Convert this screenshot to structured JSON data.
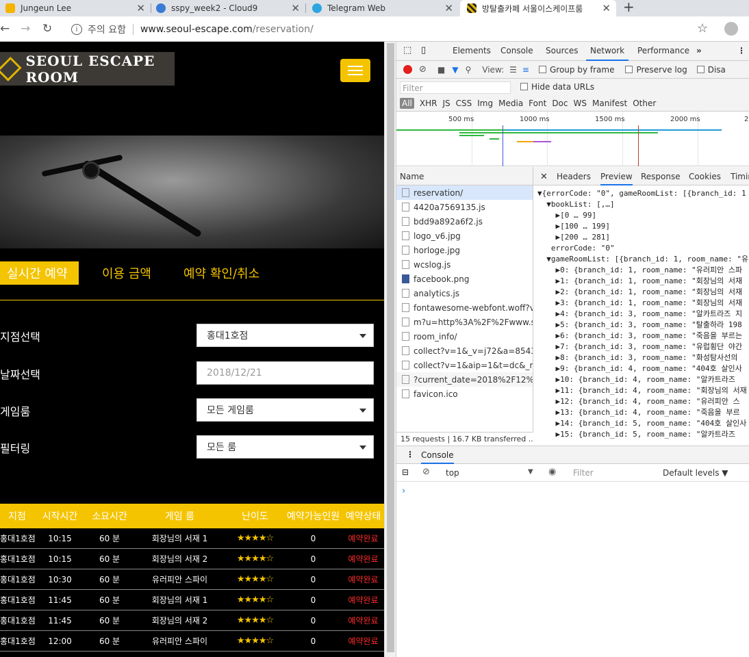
{
  "browser": {
    "tabs": [
      {
        "title": "Jungeun Lee",
        "icon": "google-icon"
      },
      {
        "title": "sspy_week2 - Cloud9",
        "icon": "cloud9-icon"
      },
      {
        "title": "Telegram Web",
        "icon": "telegram-icon"
      },
      {
        "title": "방탈출카페 서울이스케이프룸",
        "icon": "seoul-escape-icon"
      }
    ],
    "warning": "주의 요함",
    "url_host": "www.seoul-escape.com",
    "url_path": "/reservation/"
  },
  "site": {
    "logo_text": "SEOUL ESCAPE ROOM",
    "tabs": [
      "실시간 예약",
      "이용 금액",
      "예약 확인/취소"
    ],
    "filters": [
      {
        "label": "지점선택",
        "value": "홍대1호점"
      },
      {
        "label": "날짜선택",
        "value": "2018/12/21"
      },
      {
        "label": "게임룸",
        "value": "모든 게임룸"
      },
      {
        "label": "필터링",
        "value": "모든 룸"
      }
    ],
    "table": {
      "headers": [
        "지점",
        "시작시간",
        "소요시간",
        "게임 룸",
        "난이도",
        "예약가능인원",
        "예약상태"
      ],
      "rows": [
        [
          "홍대1호점",
          "10:15",
          "60 분",
          "회장님의 서재 1",
          "★★★★☆",
          "0",
          "예약완료"
        ],
        [
          "홍대1호점",
          "10:15",
          "60 분",
          "회장님의 서재 2",
          "★★★★☆",
          "0",
          "예약완료"
        ],
        [
          "홍대1호점",
          "10:30",
          "60 분",
          "유러피안 스파이",
          "★★★★☆",
          "0",
          "예약완료"
        ],
        [
          "홍대1호점",
          "11:45",
          "60 분",
          "회장님의 서재 1",
          "★★★★☆",
          "0",
          "예약완료"
        ],
        [
          "홍대1호점",
          "11:45",
          "60 분",
          "회장님의 서재 2",
          "★★★★☆",
          "0",
          "예약완료"
        ],
        [
          "홍대1호점",
          "12:00",
          "60 분",
          "유러피안 스파이",
          "★★★★☆",
          "0",
          "예약완료"
        ]
      ]
    }
  },
  "devtools": {
    "panels": [
      "Elements",
      "Console",
      "Sources",
      "Network",
      "Performance"
    ],
    "toolbar": {
      "view": "View:",
      "group": "Group by frame",
      "preserve": "Preserve log",
      "disable": "Disa"
    },
    "filter_placeholder": "Filter",
    "hide_data": "Hide data URLs",
    "types": [
      "All",
      "XHR",
      "JS",
      "CSS",
      "Img",
      "Media",
      "Font",
      "Doc",
      "WS",
      "Manifest",
      "Other"
    ],
    "ticks": [
      "500 ms",
      "1000 ms",
      "1500 ms",
      "2000 ms",
      "2"
    ],
    "name_header": "Name",
    "requests": [
      "reservation/",
      "4420a7569135.js",
      "bdd9a892a6f2.js",
      "logo_v6.jpg",
      "horloge.jpg",
      "wcslog.js",
      "facebook.png",
      "analytics.js",
      "fontawesome-webfont.woff?v...",
      "m?u=http%3A%2F%2Fwww.se...",
      "room_info/",
      "collect?v=1&_v=j72&a=85439...",
      "collect?v=1&aip=1&t=dc&_r=...",
      "?current_date=2018%2F12%2F...",
      "favicon.ico"
    ],
    "detail_tabs": [
      "Headers",
      "Preview",
      "Response",
      "Cookies",
      "Timin"
    ],
    "preview_lines": [
      "▼{errorCode: \"0\", gameRoomList: [{branch_id: 1",
      "  ▼bookList: [,…]",
      "    ▶[0 … 99]",
      "    ▶[100 … 199]",
      "    ▶[200 … 281]",
      "   errorCode: \"0\"",
      "  ▼gameRoomList: [{branch_id: 1, room_name: \"유",
      "    ▶0: {branch_id: 1, room_name: \"유러피안 스파",
      "    ▶1: {branch_id: 1, room_name: \"회장님의 서재",
      "    ▶2: {branch_id: 1, room_name: \"회장님의 서재",
      "    ▶3: {branch_id: 1, room_name: \"회장님의 서재",
      "    ▶4: {branch_id: 3, room_name: \"알카트라즈 지",
      "    ▶5: {branch_id: 3, room_name: \"탈출하라 198",
      "    ▶6: {branch_id: 3, room_name: \"죽음을 부르는",
      "    ▶7: {branch_id: 3, room_name: \"유럽횡단 야간",
      "    ▶8: {branch_id: 3, room_name: \"화성탐사선의",
      "    ▶9: {branch_id: 4, room_name: \"404호 살인사",
      "    ▶10: {branch_id: 4, room_name: \"알카트라즈",
      "    ▶11: {branch_id: 4, room_name: \"회장님의 서재",
      "    ▶12: {branch_id: 4, room_name: \"유러피안 스",
      "    ▶13: {branch_id: 4, room_name: \"죽음을 부르",
      "    ▶14: {branch_id: 5, room_name: \"404호 살인사",
      "    ▶15: {branch_id: 5, room_name: \"알카트라즈"
    ],
    "status": "15 requests | 16.7 KB transferred ...",
    "console_tab": "Console",
    "context": "top",
    "levels": "Default levels ▼",
    "console_filter_placeholder": "Filter",
    "prompt": "›"
  }
}
